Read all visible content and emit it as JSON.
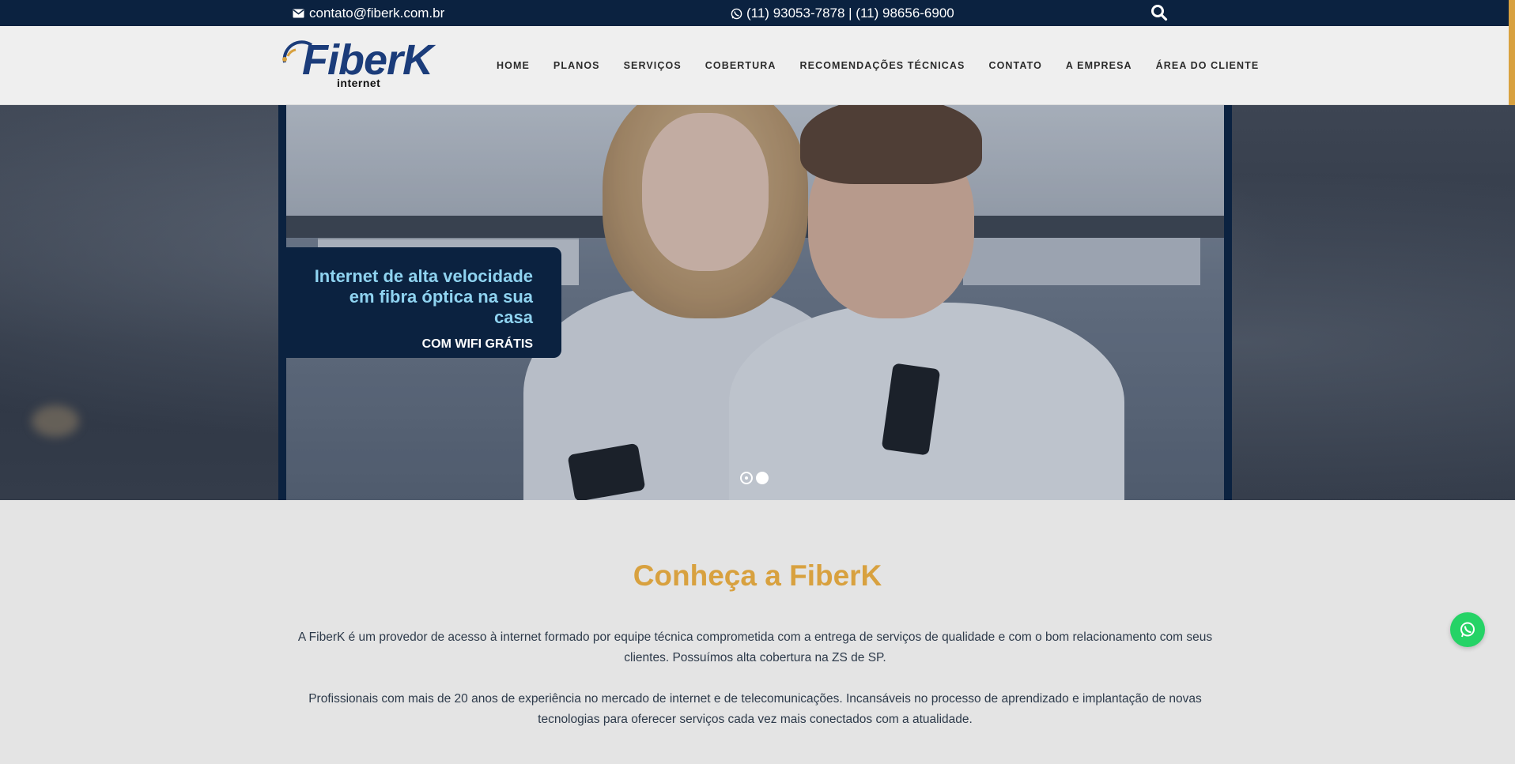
{
  "topbar": {
    "email": "contato@fiberk.com.br",
    "phones": "(11) 93053-7878 | (11) 98656-6900",
    "search_icon": "search-icon"
  },
  "header": {
    "logo_text": "FiberK",
    "logo_sub": "internet",
    "nav": [
      "HOME",
      "PLANOS",
      "SERVIÇOS",
      "COBERTURA",
      "RECOMENDAÇÕES TÉCNICAS",
      "CONTATO",
      "A EMPRESA",
      "ÁREA DO CLIENTE"
    ]
  },
  "hero": {
    "headline": "Internet de alta velocidade em fibra óptica na sua casa",
    "subline": "COM WIFI GRÁTIS",
    "slides_count": 2,
    "active_slide": 1
  },
  "about": {
    "title": "Conheça a FiberK",
    "paragraph1": "A FiberK é um provedor de acesso à internet formado por equipe técnica comprometida com a entrega de serviços de qualidade e com o bom relacionamento com seus clientes. Possuímos alta cobertura na ZS de SP.",
    "paragraph2": "Profissionais com mais de 20 anos de experiência no mercado de internet e de telecomunicações. Incansáveis no processo de aprendizado e implantação de novas tecnologias para oferecer serviços cada vez mais conectados com a atualidade."
  },
  "colors": {
    "navy": "#0b2240",
    "gold": "#d8a13f",
    "cyan_text": "#8fd3f0",
    "whatsapp_green": "#25d366"
  }
}
